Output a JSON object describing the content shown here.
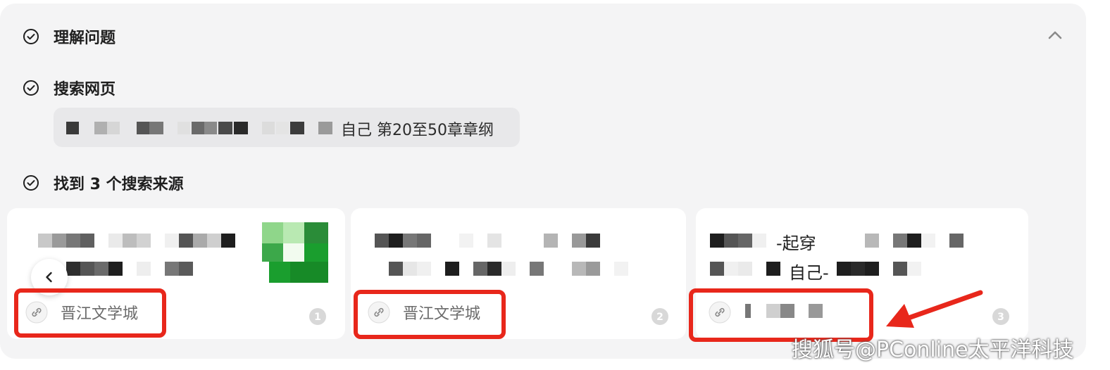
{
  "steps": [
    {
      "label": "理解问题"
    },
    {
      "label": "搜索网页"
    },
    {
      "label": "找到 3 个搜索来源"
    }
  ],
  "query": {
    "text_visible": "自己 第20至50章章纲"
  },
  "sources": [
    {
      "site": "晋江文学城",
      "index": "1"
    },
    {
      "site": "晋江文学城",
      "index": "2"
    },
    {
      "site": "",
      "index": "3",
      "title_fragment_1": "-起穿",
      "title_fragment_2": "自己-"
    }
  ],
  "icons": {
    "step_done": "check-circle-icon",
    "collapse": "chevron-up-icon",
    "source_link": "link-icon",
    "prev": "chevron-left-icon"
  },
  "colors": {
    "panel_bg": "#f4f4f5",
    "card_bg": "#ffffff",
    "annotation_red": "#e8271b",
    "query_bg": "#e8e8ea",
    "site_logo_green": "#1a9e2e"
  },
  "watermark": "搜狐号@PConline太平洋科技"
}
